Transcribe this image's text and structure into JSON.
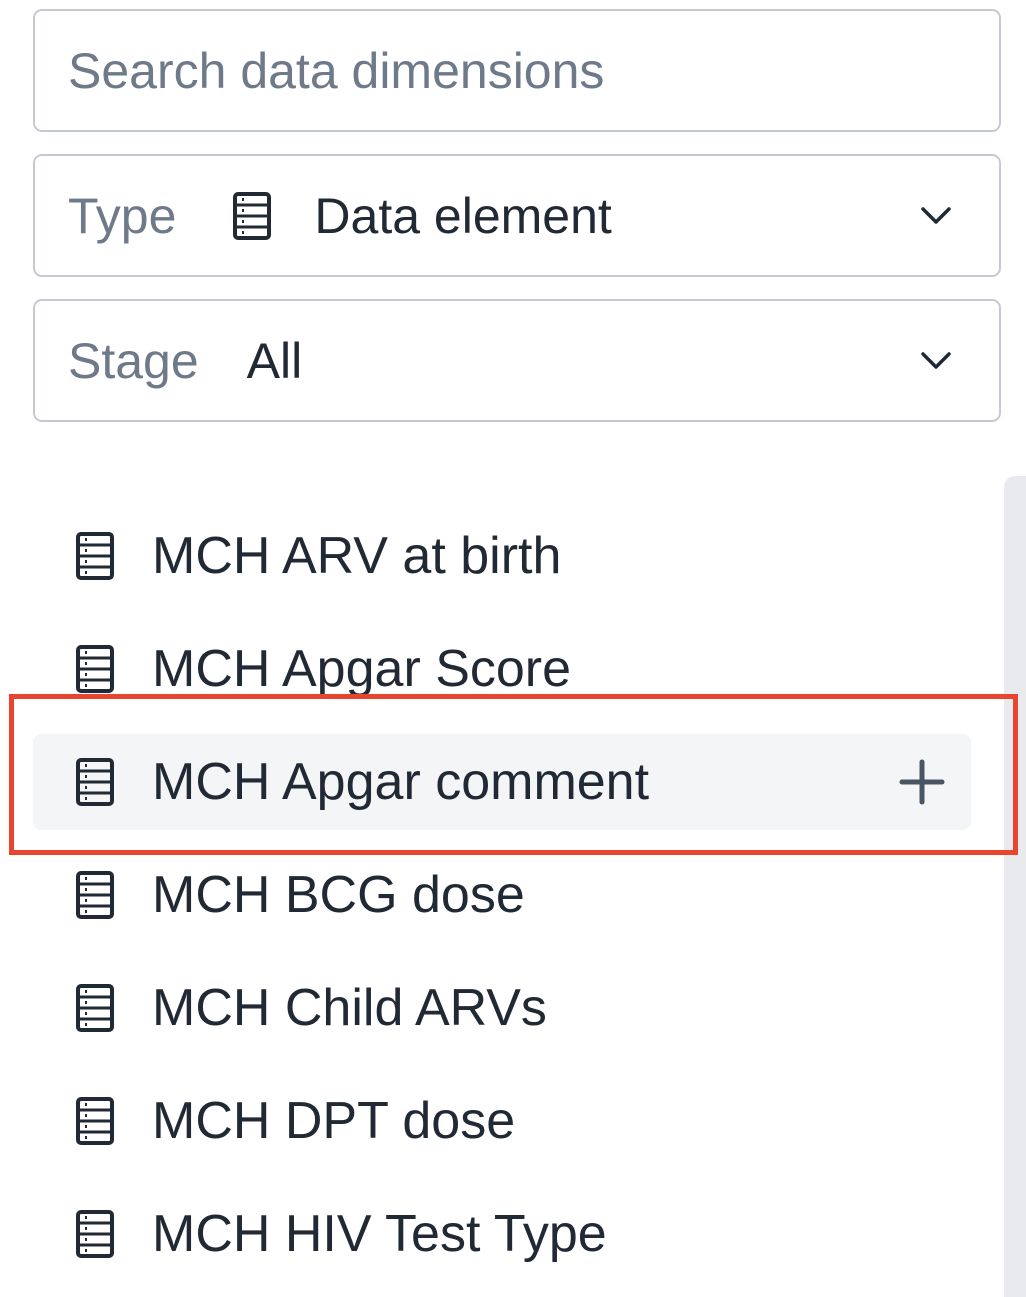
{
  "search": {
    "placeholder": "Search data dimensions",
    "value": ""
  },
  "type_filter": {
    "label": "Type",
    "value": "Data element",
    "icon": "data-element-icon"
  },
  "stage_filter": {
    "label": "Stage",
    "value": "All"
  },
  "dimension_list": {
    "items": [
      {
        "label": "MCH ARV at birth",
        "icon": "data-element-icon"
      },
      {
        "label": "MCH Apgar Score",
        "icon": "data-element-icon"
      },
      {
        "label": "MCH Apgar comment",
        "icon": "data-element-icon",
        "hovered": true,
        "action_icon": "plus-icon"
      },
      {
        "label": "MCH BCG dose",
        "icon": "data-element-icon"
      },
      {
        "label": "MCH Child ARVs",
        "icon": "data-element-icon"
      },
      {
        "label": "MCH DPT dose",
        "icon": "data-element-icon"
      },
      {
        "label": "MCH HIV Test Type",
        "icon": "data-element-icon"
      }
    ]
  },
  "colors": {
    "border": "#c5cad2",
    "placeholder_text": "#6e7a8a",
    "text": "#212934",
    "hover_background": "#f3f5f7",
    "highlight": "#e8442e"
  }
}
